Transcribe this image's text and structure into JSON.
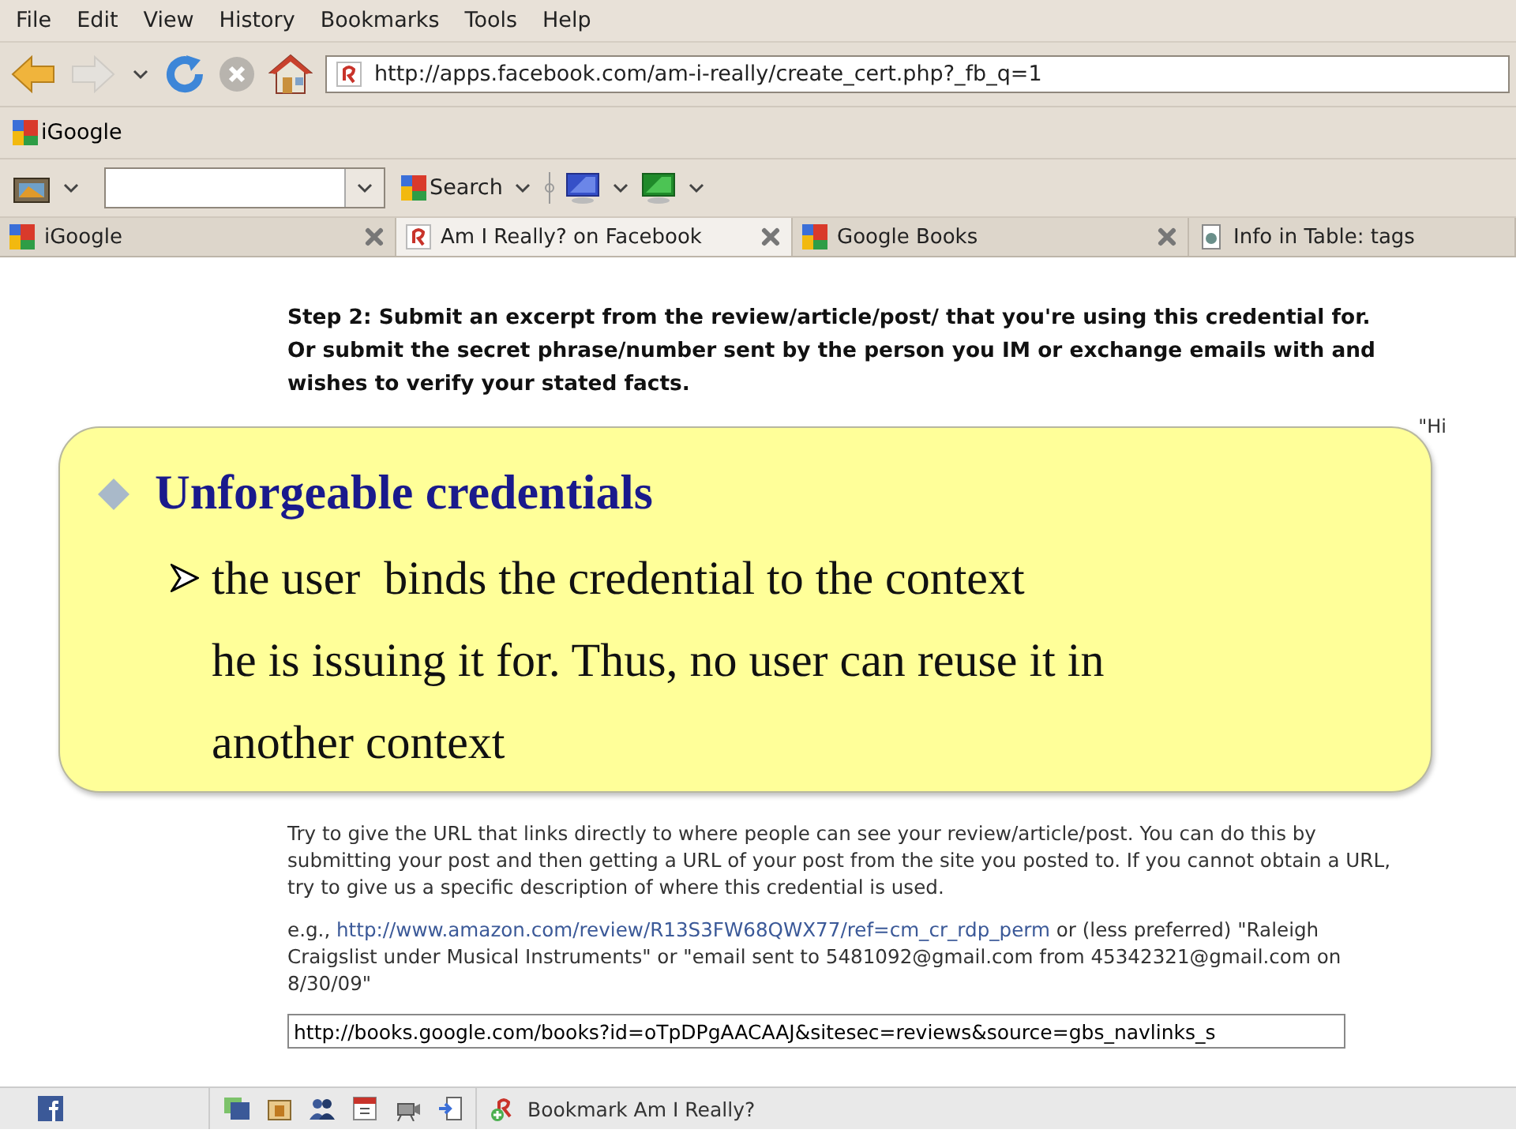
{
  "menu": [
    "File",
    "Edit",
    "View",
    "History",
    "Bookmarks",
    "Tools",
    "Help"
  ],
  "navigation": {
    "url": "http://apps.facebook.com/am-i-really/create_cert.php?_fb_q=1"
  },
  "bookmarks": [
    {
      "label": "iGoogle"
    }
  ],
  "toolbar": {
    "search_button": "Search"
  },
  "tabs": [
    {
      "label": "iGoogle",
      "selected": false,
      "kind": "google"
    },
    {
      "label": "Am I Really? on Facebook",
      "selected": true,
      "kind": "app"
    },
    {
      "label": "Google Books",
      "selected": false,
      "kind": "google"
    },
    {
      "label": "Info in Table: tags",
      "selected": false,
      "kind": "page"
    }
  ],
  "content": {
    "step": "Step 2: Submit an excerpt from the review/article/post/ that you're using this credential for. Or submit the secret phrase/number sent by the person you IM or exchange emails with and wishes to verify your stated facts.",
    "edge_text": "\"Hi",
    "help": "Try to give the URL that links directly to where people can see your review/article/post. You can do this by submitting your post and then getting a URL of your post from the site you posted to. If you cannot obtain a URL, try to give us a specific description of where this credential is used.",
    "example": {
      "prefix": "e.g., ",
      "link": "http://www.amazon.com/review/R13S3FW68QWX77/ref=cm_cr_rdp_perm",
      "suffix": " or (less preferred) \"Raleigh Craigslist under Musical Instruments\" or \"email sent to 5481092@gmail.com from 45342321@gmail.com on 8/30/09\""
    },
    "url_field": {
      "value": "http://books.google.com/books?id=oTpDPgAACAAJ&sitesec=reviews&source=gbs_navlinks_s"
    }
  },
  "status_bar": {
    "bookmark": "Bookmark Am I Really?"
  },
  "callout": {
    "title": "Unforgeable credentials",
    "bullet_lines": [
      "the user  binds the credential to the context",
      "he is issuing it for. Thus, no user can reuse it in",
      "another context"
    ]
  }
}
